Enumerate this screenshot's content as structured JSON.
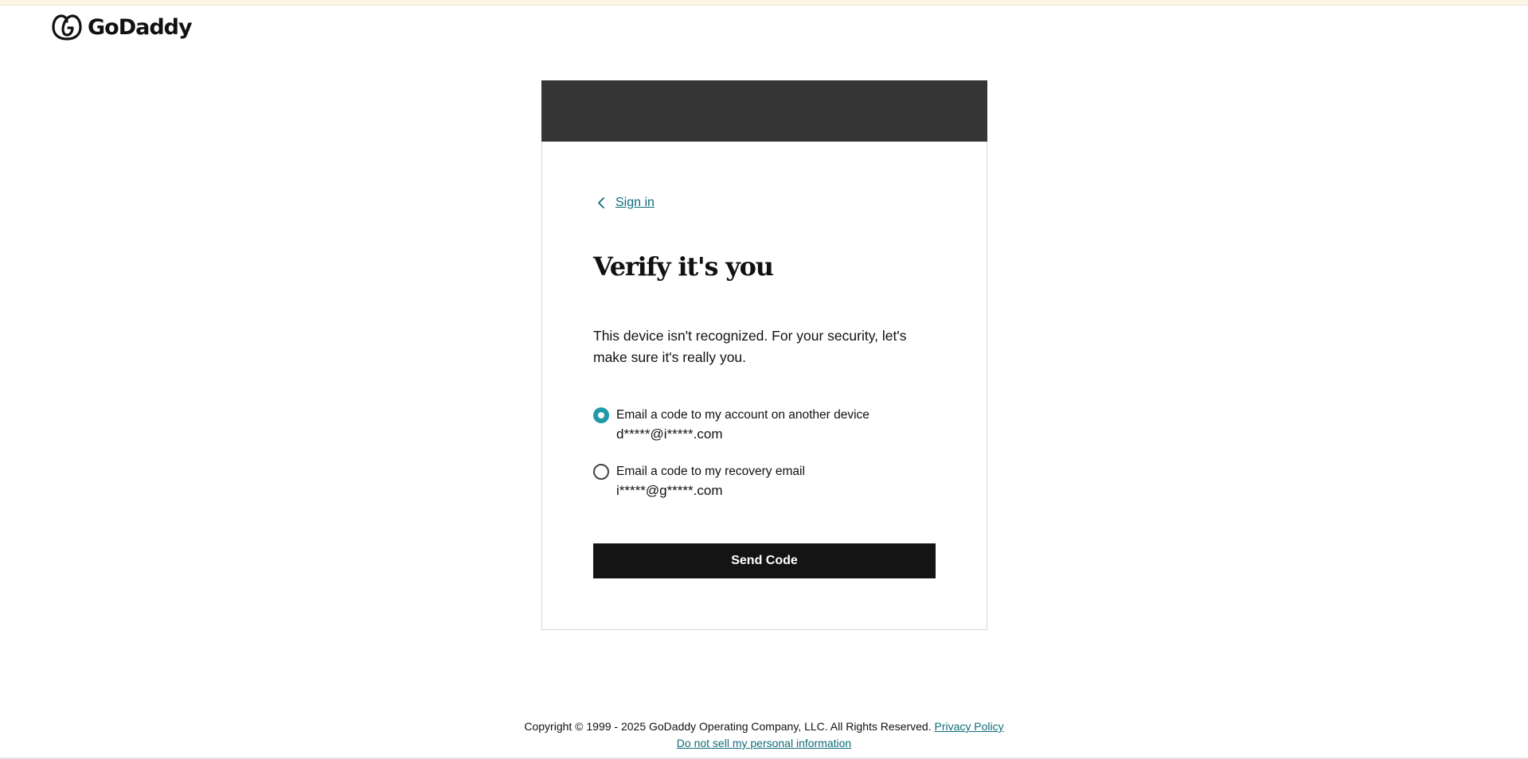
{
  "header": {
    "logo_text": "GoDaddy",
    "logo_icon": "godaddy-logo-icon"
  },
  "card": {
    "back_link_label": "Sign in",
    "back_icon": "chevron-left-icon",
    "title": "Verify it's you",
    "description": "This device isn't recognized. For your security, let's make sure it's really you.",
    "options": [
      {
        "label": "Email a code to my account on another device",
        "email": "d*****@i*****.com",
        "selected": true
      },
      {
        "label": "Email a code to my recovery email",
        "email": "i*****@g*****.com",
        "selected": false
      }
    ],
    "send_button_label": "Send Code"
  },
  "footer": {
    "copyright": "Copyright © 1999 - 2025 GoDaddy Operating Company, LLC. All Rights Reserved.",
    "privacy_link": "Privacy Policy",
    "do_not_sell_link": "Do not sell my personal information"
  },
  "colors": {
    "banner": "#353535",
    "accent_teal": "#1f9aa6",
    "link": "#0e6c7a",
    "button": "#141414"
  }
}
